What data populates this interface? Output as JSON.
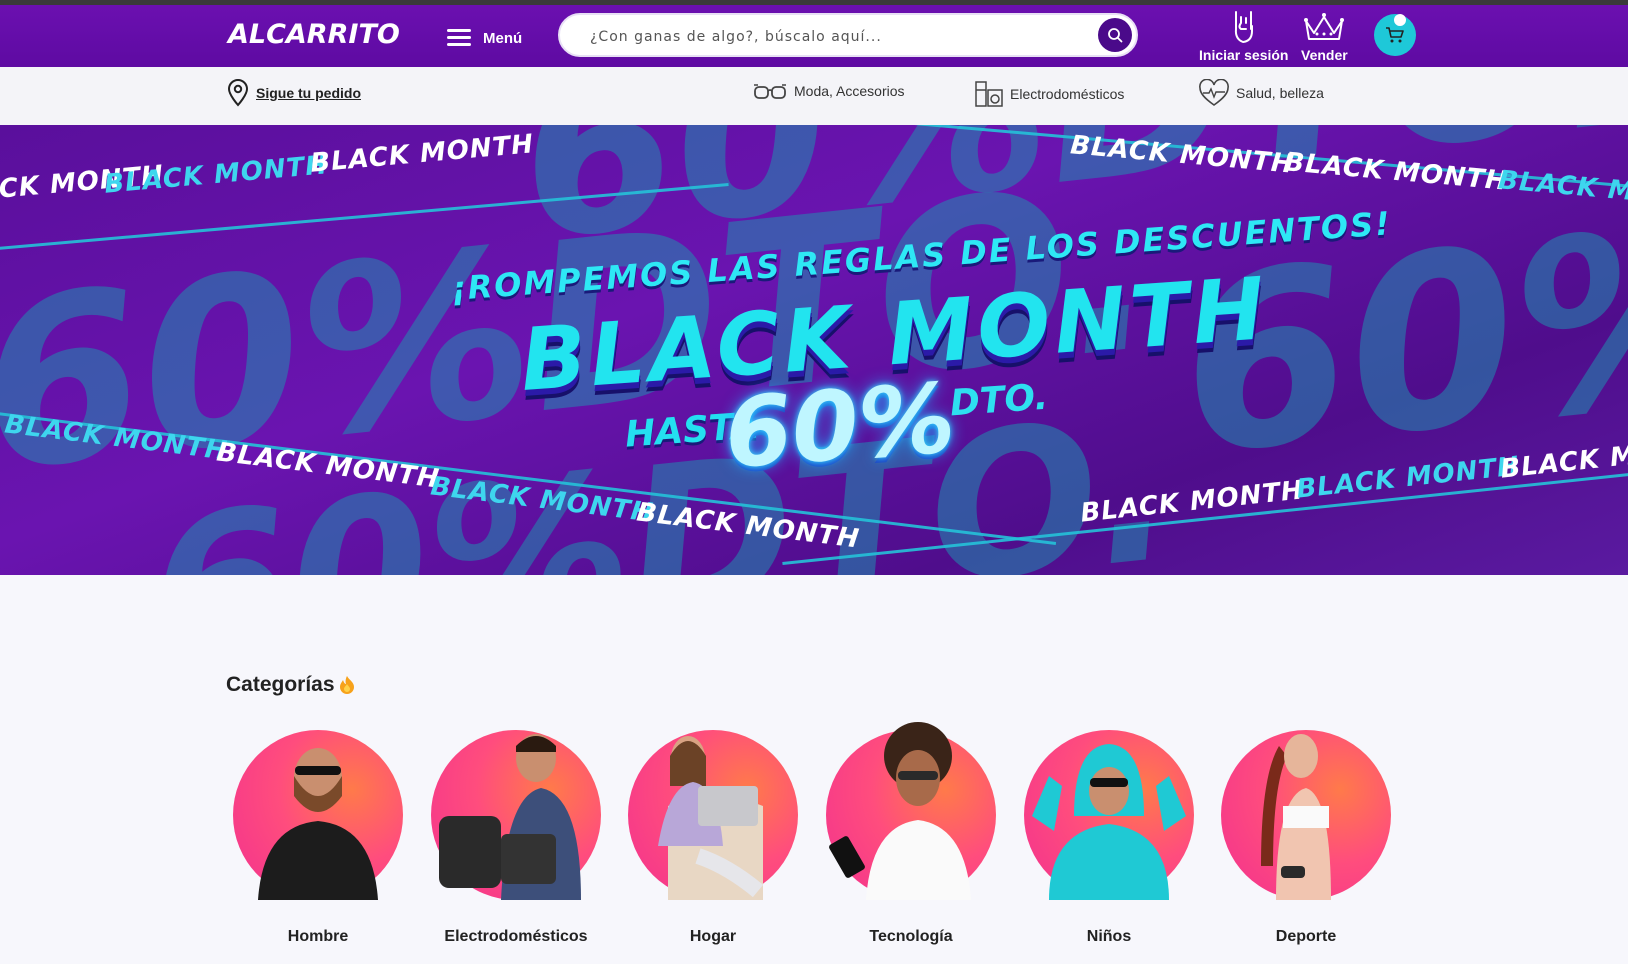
{
  "brand": {
    "logo_text": "ALCARRITO"
  },
  "header": {
    "menu_label": "Menú",
    "search_placeholder": "¿Con ganas de algo?, búscalo aquí...",
    "login_label": "Iniciar sesión",
    "sell_label": "Vender",
    "icons": [
      "menu-icon",
      "search-icon",
      "rock-hand-icon",
      "crown-icon",
      "cart-icon"
    ]
  },
  "subnav": {
    "track_label": "Sigue tu pedido",
    "categories": [
      {
        "label": "Moda, Accesorios",
        "icon": "glasses-icon"
      },
      {
        "label": "Electrodomésticos",
        "icon": "appliance-icon"
      },
      {
        "label": "Salud, belleza",
        "icon": "heart-pulse-icon"
      }
    ]
  },
  "banner": {
    "headline": "¡ROMPEMOS LAS REGLAS DE LOS DESCUENTOS!",
    "title": "BLACK MONTH",
    "hasta": "HASTA",
    "percent": "60%",
    "dto": "DTO.",
    "repeat_text": "BLACK MONTH",
    "bg_text": "60%DTO."
  },
  "categories": {
    "title": "Categorías",
    "items": [
      {
        "label": "Hombre"
      },
      {
        "label": "Electrodomésticos"
      },
      {
        "label": "Hogar"
      },
      {
        "label": "Tecnología"
      },
      {
        "label": "Niños"
      },
      {
        "label": "Deporte"
      }
    ]
  },
  "colors": {
    "header": "#6a0dad",
    "accent_cyan": "#1ec8d8",
    "search_button": "#4a0a8a",
    "category_gradient": [
      "#ff7a4a",
      "#f2308f"
    ]
  }
}
